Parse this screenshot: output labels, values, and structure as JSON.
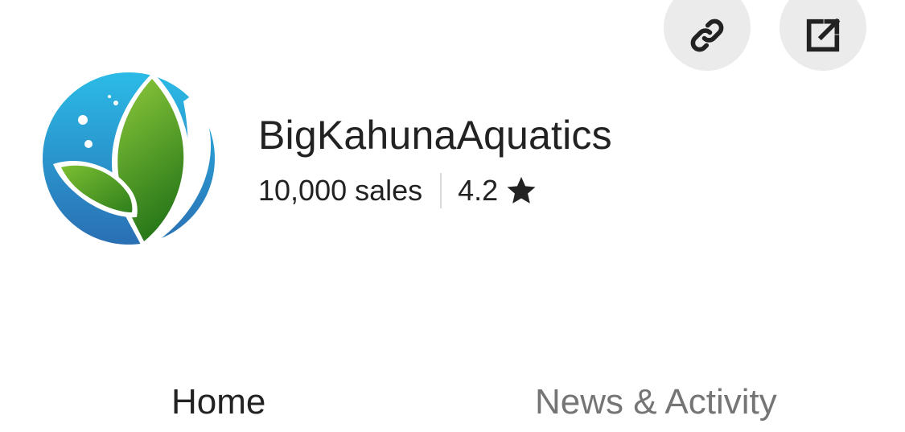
{
  "header": {
    "actions": [
      {
        "icon": "link-icon",
        "label": ""
      },
      {
        "icon": "external-share-icon",
        "label": ""
      }
    ]
  },
  "shop": {
    "name": "BigKahunaAquatics",
    "sales": "10,000 sales",
    "rating": "4.2",
    "rating_icon": "star-icon",
    "logo": {
      "icon": "leaf-water-logo",
      "colors": {
        "water_top": "#2bbbe6",
        "water_bottom": "#2a6fb3",
        "leaf_light": "#8cc83a",
        "leaf_dark": "#2a7a1a"
      }
    }
  },
  "tabs": [
    {
      "label": "Home",
      "active": true
    },
    {
      "label": "News & Activity",
      "active": false
    }
  ],
  "colors": {
    "text_primary": "#222222",
    "text_secondary": "#757575",
    "icon_button_bg": "#ebebeb",
    "divider": "#d9d9d9"
  }
}
